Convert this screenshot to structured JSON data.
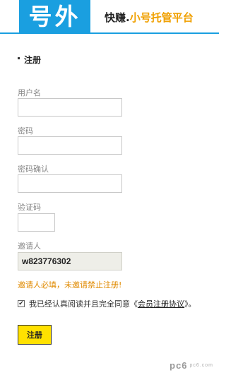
{
  "header": {
    "logo_text": "号外",
    "slogan_part1": "快赚.",
    "slogan_part2": "小号托管平台",
    "brand_color": "#1a9fe0",
    "accent_color": "#f0a000"
  },
  "form": {
    "title": "注册",
    "username_label": "用户名",
    "username_value": "",
    "password_label": "密码",
    "password_value": "",
    "confirm_label": "密码确认",
    "confirm_value": "",
    "captcha_label": "验证码",
    "captcha_value": "",
    "inviter_label": "邀请人",
    "inviter_value": "w823776302",
    "warning": "邀请人必填，未邀请禁止注册!",
    "agree_prefix": "我已经认真阅读并且完全同意《",
    "agree_link": "会员注册协议",
    "agree_suffix": "》。",
    "agree_checked": true,
    "submit_label": "注册"
  },
  "watermark": {
    "text": "pc6",
    "small": "pc6.com"
  }
}
